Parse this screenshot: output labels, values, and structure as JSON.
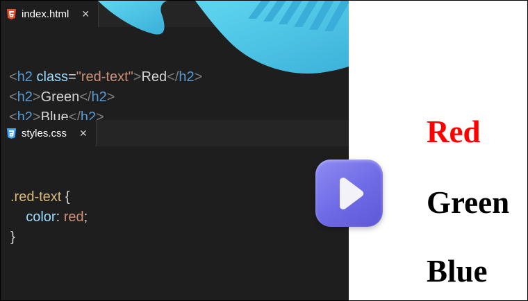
{
  "tabs": [
    {
      "name": "index.html",
      "icon": "html5-icon",
      "icon_color": "#e44d26"
    },
    {
      "name": "styles.css",
      "icon": "css3-icon",
      "icon_color": "#42a5f5"
    }
  ],
  "html_code": {
    "line1": {
      "open_lt": "<",
      "tag": "h2",
      "attr": " class",
      "eq": "=",
      "value": "\"red-text\"",
      "gt": ">",
      "text": "Red",
      "close_lt": "</",
      "close_tag": "h2",
      "close_gt": ">"
    },
    "line2": {
      "open_lt": "<",
      "tag": "h2",
      "gt": ">",
      "text": "Green",
      "close_lt": "</",
      "close_tag": "h2",
      "close_gt": ">"
    },
    "line3": {
      "open_lt": "<",
      "tag": "h2",
      "gt": ">",
      "text": "Blue",
      "close_lt": "</",
      "close_tag": "h2",
      "close_gt": ">"
    }
  },
  "css_code": {
    "selector": ".red-text",
    "open_brace": " {",
    "property": "color",
    "colon": ": ",
    "value": "red",
    "semicolon": ";",
    "close_brace": "}"
  },
  "preview": {
    "items": [
      "Red",
      "Green",
      "Blue"
    ],
    "red_color": "#ff0000"
  },
  "colors": {
    "editor_bg": "#1e1e1e",
    "tabbar_bg": "#252526",
    "play_button": "#7471ea",
    "decoration": "#45c8e8"
  }
}
